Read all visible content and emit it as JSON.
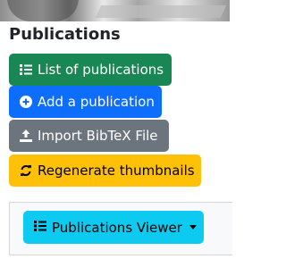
{
  "header_image": {
    "alt_icon": "cropped-photo"
  },
  "section": {
    "title": "Publications"
  },
  "buttons": {
    "list": {
      "label": "List of publications",
      "icon": "list-icon",
      "color": "#198754"
    },
    "add": {
      "label": "Add a publication",
      "icon": "plus-circle-icon",
      "color": "#0d6efd"
    },
    "import": {
      "label": "Import BibTeX File",
      "icon": "upload-icon",
      "color": "#6c757d"
    },
    "regenerate": {
      "label": "Regenerate thumbnails",
      "icon": "sync-icon",
      "color": "#ffc107"
    }
  },
  "viewer": {
    "label": "Publications Viewer",
    "icon": "list-icon",
    "color": "#0dcaf0"
  }
}
